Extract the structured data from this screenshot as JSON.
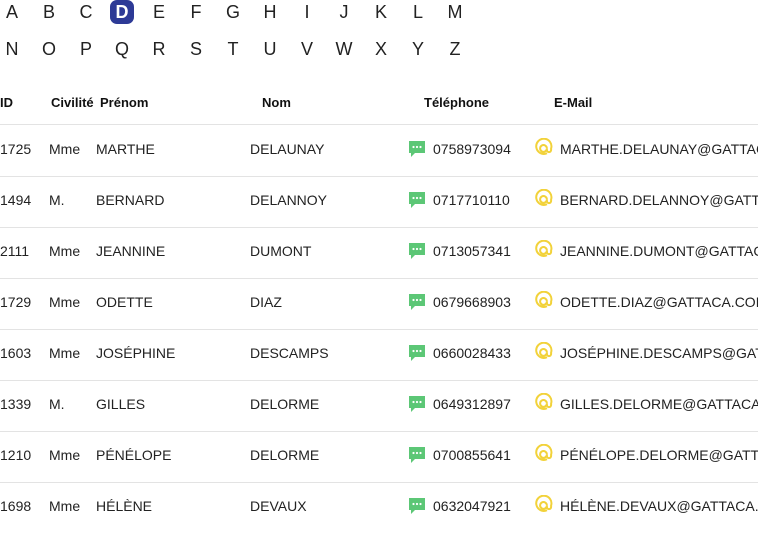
{
  "alphabet": {
    "row1": [
      "A",
      "B",
      "C",
      "D",
      "E",
      "F",
      "G",
      "H",
      "I",
      "J",
      "K",
      "L",
      "M"
    ],
    "row2": [
      "N",
      "O",
      "P",
      "Q",
      "R",
      "S",
      "T",
      "U",
      "V",
      "W",
      "X",
      "Y",
      "Z"
    ],
    "selected": "D",
    "accent_color": "#2d3a96"
  },
  "table": {
    "headers": {
      "id": "ID",
      "civilite": "Civilité",
      "prenom": "Prénom",
      "nom": "Nom",
      "telephone": "Téléphone",
      "email": "E-Mail"
    },
    "phone_icon": "sms-bubble-icon",
    "phone_icon_color": "#5cc776",
    "email_icon": "at-sign-icon",
    "email_icon_color": "#f2d23a",
    "rows": [
      {
        "id": "1725",
        "civilite": "Mme",
        "prenom": "MARTHE",
        "nom": "DELAUNAY",
        "telephone": "0758973094",
        "email": "MARTHE.DELAUNAY@GATTAC"
      },
      {
        "id": "1494",
        "civilite": "M.",
        "prenom": "BERNARD",
        "nom": "DELANNOY",
        "telephone": "0717710110",
        "email": "BERNARD.DELANNOY@GATT"
      },
      {
        "id": "2111",
        "civilite": "Mme",
        "prenom": "JEANNINE",
        "nom": "DUMONT",
        "telephone": "0713057341",
        "email": "JEANNINE.DUMONT@GATTAC"
      },
      {
        "id": "1729",
        "civilite": "Mme",
        "prenom": "ODETTE",
        "nom": "DIAZ",
        "telephone": "0679668903",
        "email": "ODETTE.DIAZ@GATTACA.COM"
      },
      {
        "id": "1603",
        "civilite": "Mme",
        "prenom": "JOSÉPHINE",
        "nom": "DESCAMPS",
        "telephone": "0660028433",
        "email": "JOSÉPHINE.DESCAMPS@GAT"
      },
      {
        "id": "1339",
        "civilite": "M.",
        "prenom": "GILLES",
        "nom": "DELORME",
        "telephone": "0649312897",
        "email": "GILLES.DELORME@GATTACA"
      },
      {
        "id": "1210",
        "civilite": "Mme",
        "prenom": "PÉNÉLOPE",
        "nom": "DELORME",
        "telephone": "0700855641",
        "email": "PÉNÉLOPE.DELORME@GATT"
      },
      {
        "id": "1698",
        "civilite": "Mme",
        "prenom": "HÉLÈNE",
        "nom": "DEVAUX",
        "telephone": "0632047921",
        "email": "HÉLÈNE.DEVAUX@GATTACA."
      }
    ]
  }
}
